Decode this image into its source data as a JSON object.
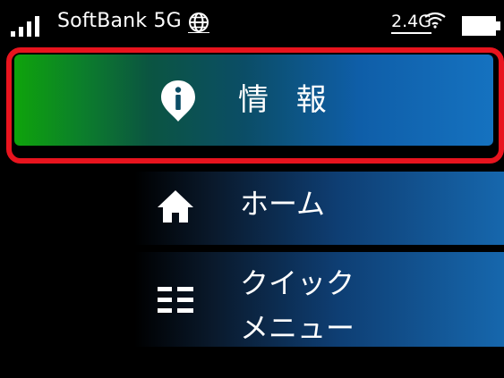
{
  "status_bar": {
    "carrier": "SoftBank 5G",
    "wifi_band": "2.4G",
    "icons": [
      "signal-bars-icon",
      "globe-icon",
      "wifi-icon",
      "battery-icon"
    ]
  },
  "menu": {
    "selected_index": 0,
    "items": [
      {
        "label": "情 報",
        "icon": "info-pin-icon",
        "selected": true
      },
      {
        "label": "ホーム",
        "icon": "home-icon",
        "selected": false
      },
      {
        "label_lines": [
          "クイック",
          "メニュー"
        ],
        "icon": "quick-menu-icon",
        "selected": false
      }
    ]
  },
  "colors": {
    "background": "#000000",
    "selection_outline": "#e8141e",
    "selected_gradient_start": "#0ea30b",
    "selected_gradient_end": "#1572c0",
    "row_gradient_end": "#1667ad",
    "text": "#ffffff"
  }
}
